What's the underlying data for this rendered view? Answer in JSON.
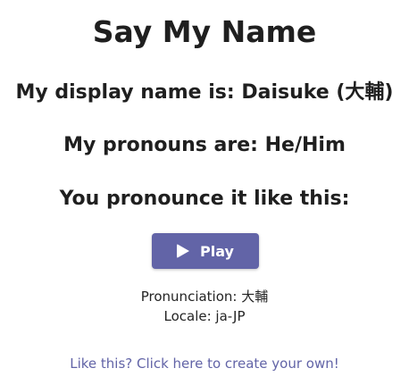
{
  "title": "Say My Name",
  "display_name": {
    "prefix": "My display name is: ",
    "value": "Daisuke (大輔)"
  },
  "pronouns": {
    "prefix": "My pronouns are: ",
    "value": "He/Him"
  },
  "pronounce_heading": "You pronounce it like this:",
  "play_button": {
    "icon": "play-icon",
    "label": "Play"
  },
  "pronunciation": {
    "label": "Pronunciation: ",
    "value": "大輔"
  },
  "locale": {
    "label": "Locale: ",
    "value": "ja-JP"
  },
  "create_link": "Like this? Click here to create your own!",
  "colors": {
    "accent": "#6264a7",
    "text": "#242424",
    "background": "#ffffff"
  }
}
